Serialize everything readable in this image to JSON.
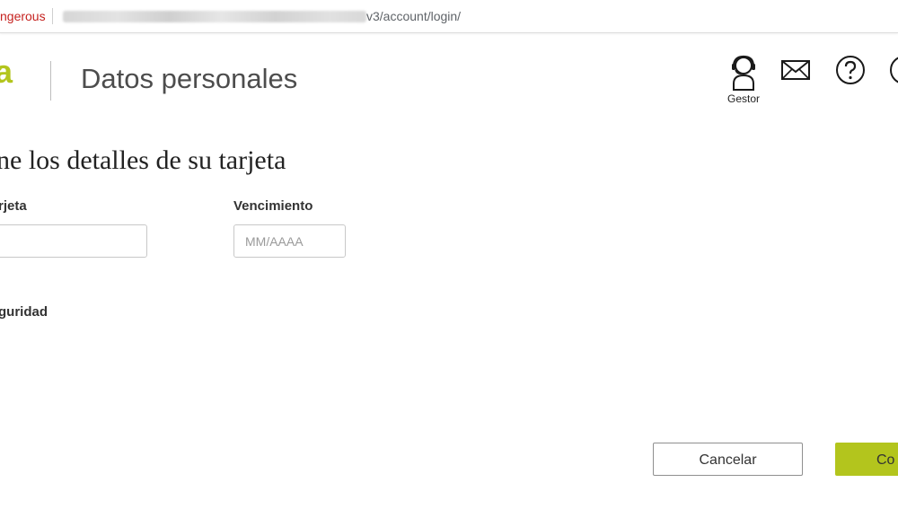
{
  "browser": {
    "security_status": "ngerous",
    "url_path": "v3/account/login/"
  },
  "header": {
    "logo_fragment": "a",
    "title": "Datos personales",
    "icons": {
      "gestor_label": "Gestor",
      "gestor_icon": "headset-user-icon",
      "mail_icon": "mail-icon",
      "help_icon": "help-icon",
      "power_icon": "power-icon"
    },
    "accent_color": "#b3c51d"
  },
  "form": {
    "heading": "ne los detalles de su tarjeta",
    "card_number_label": "rjeta",
    "card_number_value": "",
    "expiry_label": "Vencimiento",
    "expiry_placeholder": "MM/AAAA",
    "expiry_value": "",
    "security_label": "guridad"
  },
  "actions": {
    "cancel_label": "Cancelar",
    "confirm_label": "Co"
  }
}
